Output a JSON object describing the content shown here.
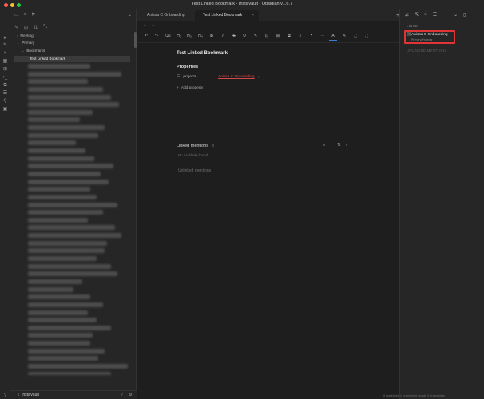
{
  "window": {
    "title": "Test Linked Bookmark - InstaVault - Obsidian v1.6.7",
    "traffic_lights": [
      "#fe5f57",
      "#febc2e",
      "#28c840"
    ]
  },
  "sidebar": {
    "tree": {
      "fleeting": "Fleeting",
      "primary": "Primary",
      "bookmarks": "Bookmarks",
      "active_file": "Test Linked Bookmark"
    },
    "vault_name": "InstaVault",
    "blurred_rows": 42
  },
  "tabs": [
    {
      "label": "Anissa C Onboarding"
    },
    {
      "label": "Test Linked Bookmark"
    }
  ],
  "new_tab": "+",
  "editor": {
    "toolbar": [
      "↶",
      "↷",
      "⌫",
      "H₂",
      "H₃",
      "H₄",
      "B",
      "I",
      "S",
      "U",
      "✎",
      "⊡",
      "⊞",
      "⧉",
      "⌕",
      "❝",
      "⋯",
      "A",
      "✎",
      "⛶",
      "⛶"
    ],
    "title": "Test Linked Bookmark",
    "properties_heading": "Properties",
    "property": {
      "key": "projects",
      "value": "Anissa C Onboarding",
      "remove_icon": "×"
    },
    "add_property": "Add property",
    "linked_mentions": "Linked mentions",
    "linked_mentions_count": "0",
    "no_backlinks": "No backlinks found.",
    "unlinked_mentions": "Unlinked mentions"
  },
  "right_panel": {
    "header": "LINKS",
    "link": {
      "title": "Anissa C Onboarding",
      "path": "Primary/Projects"
    },
    "unlinked_header": "UNLINKED MENTIONS"
  },
  "status_bar": {
    "text": "0 backlinks   1 property   0 words   0 characters"
  }
}
